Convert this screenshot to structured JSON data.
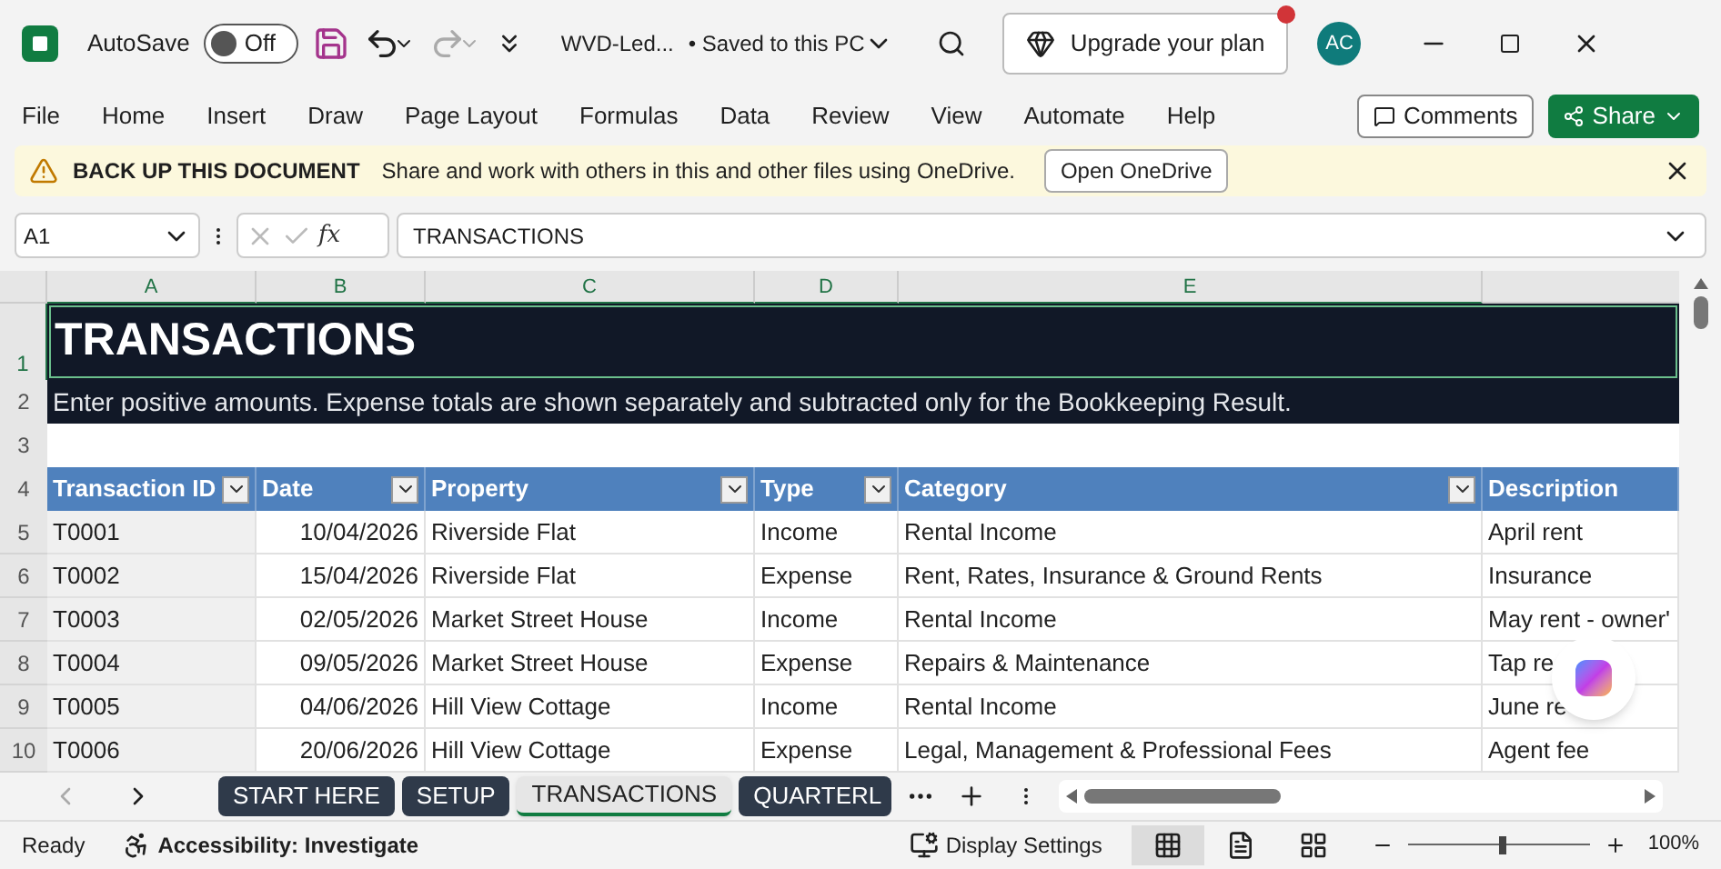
{
  "title_bar": {
    "autosave_label": "AutoSave",
    "autosave": {
      "on": false,
      "label": "Off"
    },
    "file_name": "WVD-Led...",
    "save_status": "• Saved to this PC",
    "upgrade_button": "Upgrade your plan",
    "avatar": "AC"
  },
  "ribbon_tabs": [
    "File",
    "Home",
    "Insert",
    "Draw",
    "Page Layout",
    "Formulas",
    "Data",
    "Review",
    "View",
    "Automate",
    "Help"
  ],
  "comments_button": "Comments",
  "share_button": "Share",
  "banner": {
    "title": "BACK UP THIS DOCUMENT",
    "message": "Share and work with others in this and other files using OneDrive.",
    "button": "Open OneDrive"
  },
  "name_box": "A1",
  "function_label": "fx",
  "formula": "TRANSACTIONS",
  "columns": [
    "A",
    "B",
    "C",
    "D",
    "E"
  ],
  "sheet": {
    "title": "TRANSACTIONS",
    "note": "Enter positive amounts. Expense totals are shown separately and subtracted only for the Bookkeeping Result.",
    "row_numbers": [
      "1",
      "2",
      "3",
      "4",
      "5",
      "6",
      "7",
      "8",
      "9",
      "10"
    ],
    "headers": [
      "Transaction ID",
      "Date",
      "Property",
      "Type",
      "Category",
      "Description"
    ],
    "rows": [
      {
        "cells": [
          "T0001",
          "10/04/2026",
          "Riverside Flat",
          "Income",
          "Rental Income",
          "April rent"
        ]
      },
      {
        "cells": [
          "T0002",
          "15/04/2026",
          "Riverside Flat",
          "Expense",
          "Rent, Rates, Insurance & Ground Rents",
          "Insurance"
        ]
      },
      {
        "cells": [
          "T0003",
          "02/05/2026",
          "Market Street House",
          "Income",
          "Rental Income",
          "May rent - owner'"
        ]
      },
      {
        "cells": [
          "T0004",
          "09/05/2026",
          "Market Street House",
          "Expense",
          "Repairs & Maintenance",
          "Tap re"
        ]
      },
      {
        "cells": [
          "T0005",
          "04/06/2026",
          "Hill View Cottage",
          "Income",
          "Rental Income",
          "June re"
        ]
      },
      {
        "cells": [
          "T0006",
          "20/06/2026",
          "Hill View Cottage",
          "Expense",
          "Legal, Management & Professional Fees",
          "Agent fee"
        ]
      }
    ]
  },
  "sheet_tabs": [
    {
      "label": "START HERE",
      "selected": false
    },
    {
      "label": "SETUP",
      "selected": false
    },
    {
      "label": "TRANSACTIONS",
      "selected": true
    },
    {
      "label": "QUARTERL",
      "selected": false
    }
  ],
  "status_bar": {
    "status": "Ready",
    "accessibility": "Accessibility: Investigate",
    "display_settings": "Display Settings",
    "views": [
      {
        "kind": "normal",
        "selected": true
      },
      {
        "kind": "page_layout",
        "selected": false
      },
      {
        "kind": "page_break",
        "selected": false
      }
    ],
    "zoom": {
      "level": 0.5,
      "reading": "100%"
    }
  }
}
